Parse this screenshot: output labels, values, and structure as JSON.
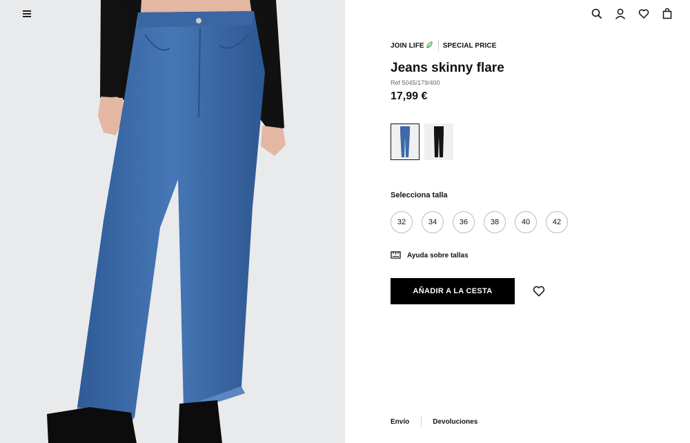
{
  "header": {
    "menu_icon": "hamburger-menu-icon",
    "icons": [
      "search-icon",
      "user-icon",
      "heart-icon",
      "shopping-bag-icon"
    ]
  },
  "product": {
    "tag_join_life": "JOIN LIFE",
    "tag_special_price": "SPECIAL PRICE",
    "title": "Jeans skinny flare",
    "ref": "Ref 5045/179/400",
    "price": "17,99 €",
    "colors": [
      {
        "name": "blue",
        "hex": "#3d6aa6",
        "selected": true
      },
      {
        "name": "black",
        "hex": "#141414",
        "selected": false
      }
    ]
  },
  "sizes": {
    "label": "Selecciona talla",
    "options": [
      "32",
      "34",
      "36",
      "38",
      "40",
      "42"
    ]
  },
  "size_help": "Ayuda sobre tallas",
  "add_to_cart": "AÑADIR A LA CESTA",
  "footer": {
    "shipping": "Envío",
    "returns": "Devoluciones"
  },
  "colors": {
    "accent": "#000000",
    "leaf": "#2e9b4b",
    "background_image": "#e9eaec"
  }
}
